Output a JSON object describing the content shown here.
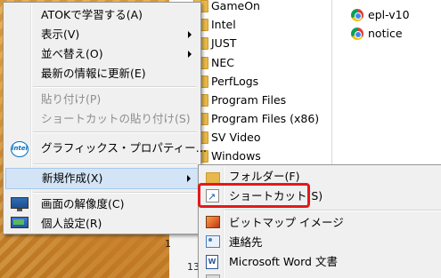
{
  "explorer": {
    "folders": [
      "GameOn",
      "Intel",
      "JUST",
      "NEC",
      "PerfLogs",
      "Program Files",
      "Program Files (x86)",
      "SV Video",
      "Windows"
    ],
    "right_items": [
      {
        "label": "epl-v10",
        "icon": "chrome-icon"
      },
      {
        "label": "notice",
        "icon": "chrome-icon"
      }
    ]
  },
  "context_menu": {
    "items": [
      {
        "label": "ATOKで学習する(A)"
      },
      {
        "label": "表示(V)",
        "submenu": true
      },
      {
        "label": "並べ替え(O)",
        "submenu": true
      },
      {
        "label": "最新の情報に更新(E)"
      },
      {
        "label": "貼り付け(P)",
        "disabled": true
      },
      {
        "label": "ショートカットの貼り付け(S)",
        "disabled": true
      },
      {
        "label": "グラフィックス・プロパティー…",
        "icon": "intel-icon"
      },
      {
        "label": "新規作成(X)",
        "submenu": true,
        "highlighted": true
      },
      {
        "label": "画面の解像度(C)",
        "icon": "display-resolution-icon"
      },
      {
        "label": "個人設定(R)",
        "icon": "personalize-icon"
      }
    ]
  },
  "new_submenu": {
    "items": [
      {
        "label": "フォルダー(F)",
        "icon": "folder-icon"
      },
      {
        "label": "ショートカット(S)",
        "icon": "shortcut-icon",
        "emphasized": true
      },
      {
        "label": "ビットマップ イメージ",
        "icon": "bitmap-icon"
      },
      {
        "label": "連絡先",
        "icon": "contact-icon"
      },
      {
        "label": "Microsoft Word 文書",
        "icon": "word-icon"
      }
    ]
  },
  "background_fragments": {
    "a": "1",
    "b": "13"
  },
  "colors": {
    "menu_bg": "#f0f0f0",
    "highlight": "#d3e4f6",
    "highlight_border": "#a8c8ec",
    "annotation_red": "#e21a1a",
    "disabled_text": "#8d8d8d"
  }
}
